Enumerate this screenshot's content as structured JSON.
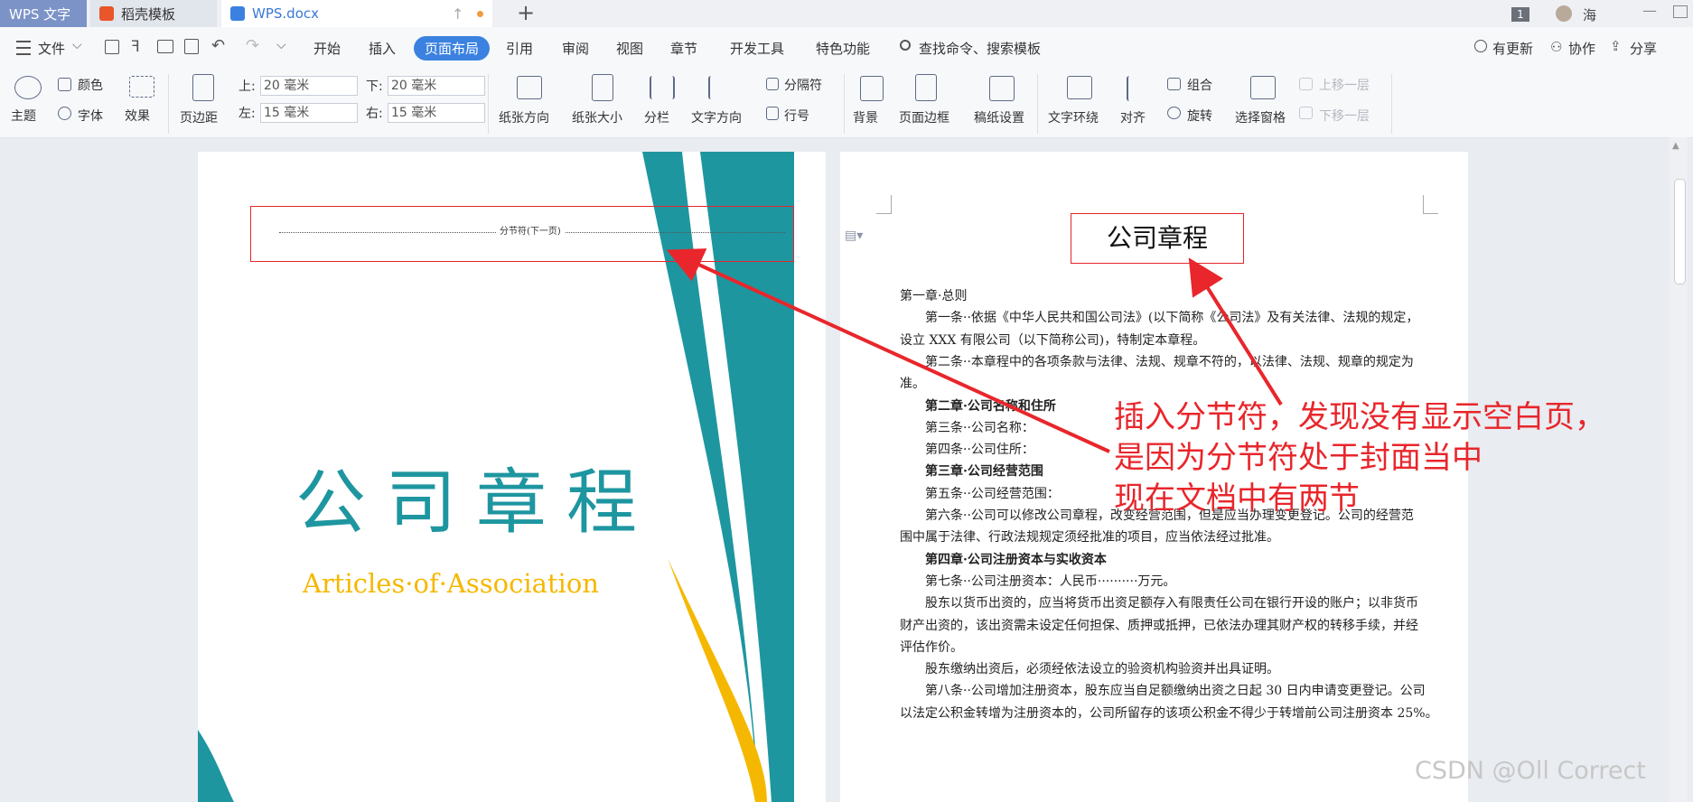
{
  "titlebar": {
    "tabs": [
      {
        "label": "WPS 文字"
      },
      {
        "label": "稻壳模板"
      },
      {
        "label": "WPS.docx"
      }
    ],
    "badge": "1",
    "user": "海"
  },
  "menu": {
    "file": "文件",
    "items": [
      "开始",
      "插入",
      "页面布局",
      "引用",
      "审阅",
      "视图",
      "章节",
      "开发工具",
      "特色功能"
    ],
    "search": "查找命令、搜索模板",
    "right": [
      "有更新",
      "协作",
      "分享"
    ]
  },
  "ribbon": {
    "theme": "主题",
    "colors": "颜色",
    "font": "字体",
    "effects": "效果",
    "margins": "页边距",
    "top_label": "上:",
    "top_value": "20 毫米",
    "bottom_label": "下:",
    "bottom_value": "20 毫米",
    "left_label": "左:",
    "left_value": "15 毫米",
    "right_label": "右:",
    "right_value": "15 毫米",
    "orientation": "纸张方向",
    "size": "纸张大小",
    "columns": "分栏",
    "text_direction": "文字方向",
    "breaks": "分隔符",
    "line_numbers": "行号",
    "background": "背景",
    "page_border": "页面边框",
    "paper_setup": "稿纸设置",
    "text_wrap": "文字环绕",
    "align": "对齐",
    "group": "组合",
    "rotate": "旋转",
    "selection_pane": "选择窗格",
    "bring_forward": "上移一层",
    "send_backward": "下移一层"
  },
  "left_page": {
    "section_break": "分节符(下一页)",
    "title_cn": "公司章程",
    "title_en": "Articles·of·Association"
  },
  "right_page": {
    "heading": "公司章程",
    "lines": [
      {
        "text": "第一章·总则",
        "indent": false,
        "bold": false
      },
      {
        "text": "第一条··依据《中华人民共和国公司法》(以下简称《公司法》及有关法律、法规的规定，",
        "indent": true,
        "bold": false
      },
      {
        "text": "设立 XXX 有限公司（以下简称公司)，特制定本章程。",
        "indent": false,
        "bold": false
      },
      {
        "text": "第二条··本章程中的各项条款与法律、法规、规章不符的，以法律、法规、规章的规定为",
        "indent": true,
        "bold": false
      },
      {
        "text": "准。",
        "indent": false,
        "bold": false
      },
      {
        "text": "第二章·公司名称和住所",
        "indent": true,
        "bold": true
      },
      {
        "text": "第三条··公司名称：",
        "indent": true,
        "bold": false
      },
      {
        "text": "第四条··公司住所：",
        "indent": true,
        "bold": false
      },
      {
        "text": "第三章·公司经营范围",
        "indent": true,
        "bold": true
      },
      {
        "text": "第五条··公司经营范围：",
        "indent": true,
        "bold": false
      },
      {
        "text": "第六条··公司可以修改公司章程，改变经营范围，但是应当办理变更登记。公司的经营范",
        "indent": true,
        "bold": false
      },
      {
        "text": "围中属于法律、行政法规规定须经批准的项目，应当依法经过批准。",
        "indent": false,
        "bold": false
      },
      {
        "text": "第四章·公司注册资本与实收资本",
        "indent": true,
        "bold": true
      },
      {
        "text": "第七条··公司注册资本：人民币··········万元。",
        "indent": true,
        "bold": false
      },
      {
        "text": "股东以货币出资的，应当将货币出资足额存入有限责任公司在银行开设的账户；以非货币",
        "indent": true,
        "bold": false
      },
      {
        "text": "财产出资的，该出资需未设定任何担保、质押或抵押，已依法办理其财产权的转移手续，并经",
        "indent": false,
        "bold": false
      },
      {
        "text": "评估作价。",
        "indent": false,
        "bold": false
      },
      {
        "text": "股东缴纳出资后，必须经依法设立的验资机构验资并出具证明。",
        "indent": true,
        "bold": false
      },
      {
        "text": "第八条··公司增加注册资本，股东应当自足额缴纳出资之日起 30 日内申请变更登记。公司",
        "indent": true,
        "bold": false
      },
      {
        "text": "以法定公积金转增为注册资本的，公司所留存的该项公积金不得少于转增前公司注册资本 25%。",
        "indent": false,
        "bold": false
      }
    ]
  },
  "annotation": {
    "lines": [
      "插入分节符，发现没有显示空白页，",
      "是因为分节符处于封面当中",
      "现在文档中有两节"
    ],
    "color": "#e8262b"
  },
  "watermark": "CSDN @Oll Correct",
  "colors": {
    "teal": "#1e96a0",
    "gold": "#f5b800",
    "accent": "#3b82e0"
  }
}
